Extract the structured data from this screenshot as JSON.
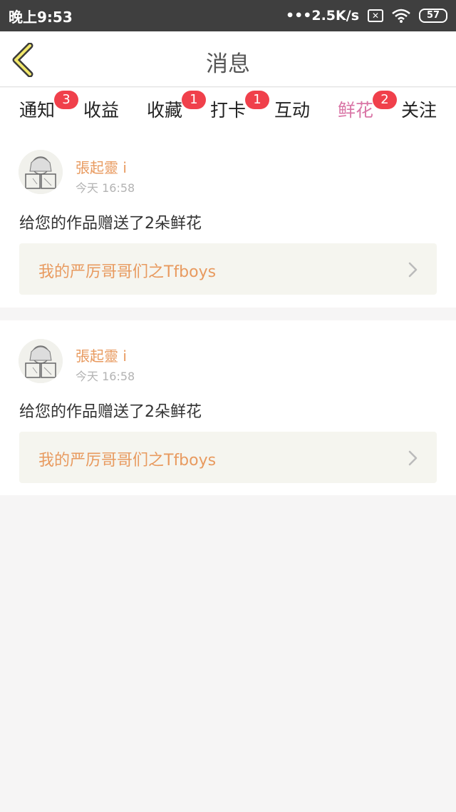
{
  "status_bar": {
    "time": "晚上9:53",
    "network_speed": "•••2.5K/s",
    "battery": "57",
    "icons": [
      "sim-off-icon",
      "wifi-icon",
      "battery-icon"
    ]
  },
  "header": {
    "title": "消息",
    "back_icon": "chevron-left-icon"
  },
  "tabs": [
    {
      "label": "通知",
      "badge": "3"
    },
    {
      "label": "收益",
      "badge": ""
    },
    {
      "label": "收藏",
      "badge": "1"
    },
    {
      "label": "打卡",
      "badge": "1"
    },
    {
      "label": "互动",
      "badge": ""
    },
    {
      "label": "鲜花",
      "badge": "2",
      "active": true
    },
    {
      "label": "关注",
      "badge": ""
    }
  ],
  "messages": [
    {
      "user": "張起靈 i",
      "time": "今天 16:58",
      "text": "给您的作品赠送了2朵鲜花",
      "work_title": "我的严厉哥哥们之Tfboys"
    },
    {
      "user": "張起靈 i",
      "time": "今天 16:58",
      "text": "给您的作品赠送了2朵鲜花",
      "work_title": "我的严厉哥哥们之Tfboys"
    }
  ],
  "colors": {
    "accent": "#d975a6",
    "orange_text": "#e89a5f",
    "badge": "#f0404b",
    "status_bar": "#3f3f3f",
    "background": "#f6f5f5"
  }
}
